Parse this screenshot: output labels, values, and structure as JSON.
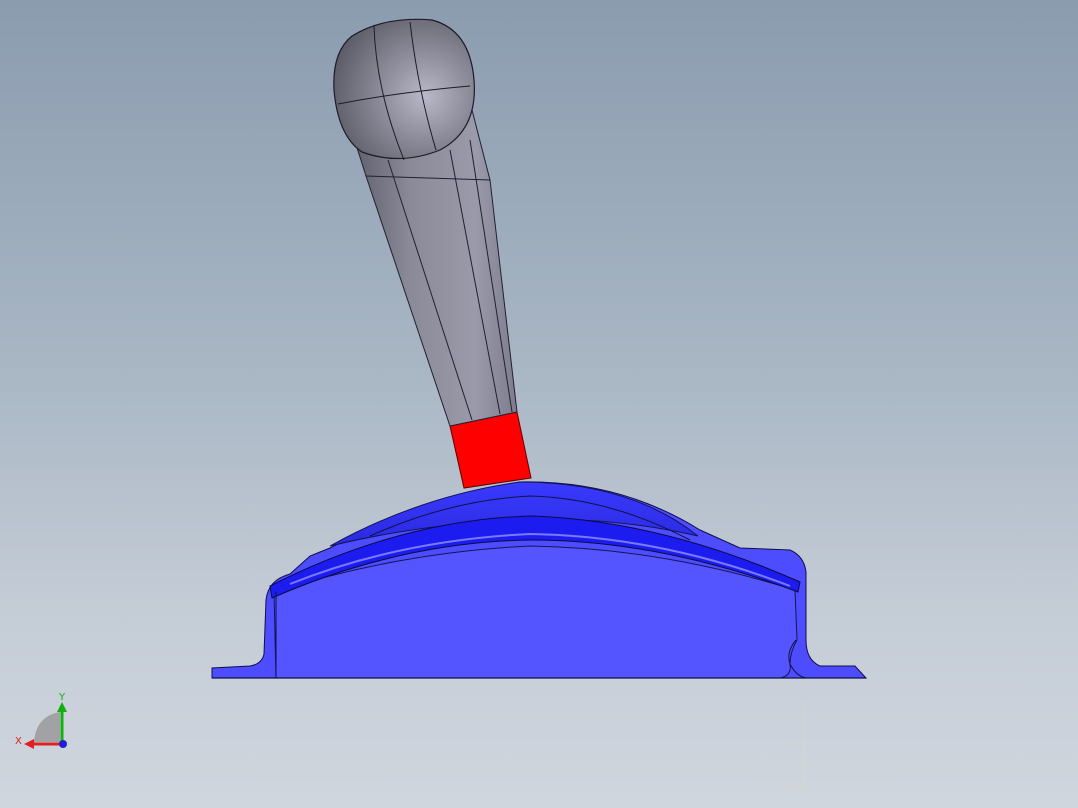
{
  "viewport": {
    "background_top": "#8b9caf",
    "background_bottom": "#d0d6de"
  },
  "model": {
    "knob_color": "#8e8e9c",
    "shaft_color": "#8a8a98",
    "collar_color": "#ff0000",
    "housing_color": "#4d4dff",
    "edge_color": "#1a1a40"
  },
  "triad": {
    "x_label": "X",
    "y_label": "Y",
    "x_color": "#e02020",
    "y_color": "#10b010",
    "z_color": "#2020d0"
  }
}
